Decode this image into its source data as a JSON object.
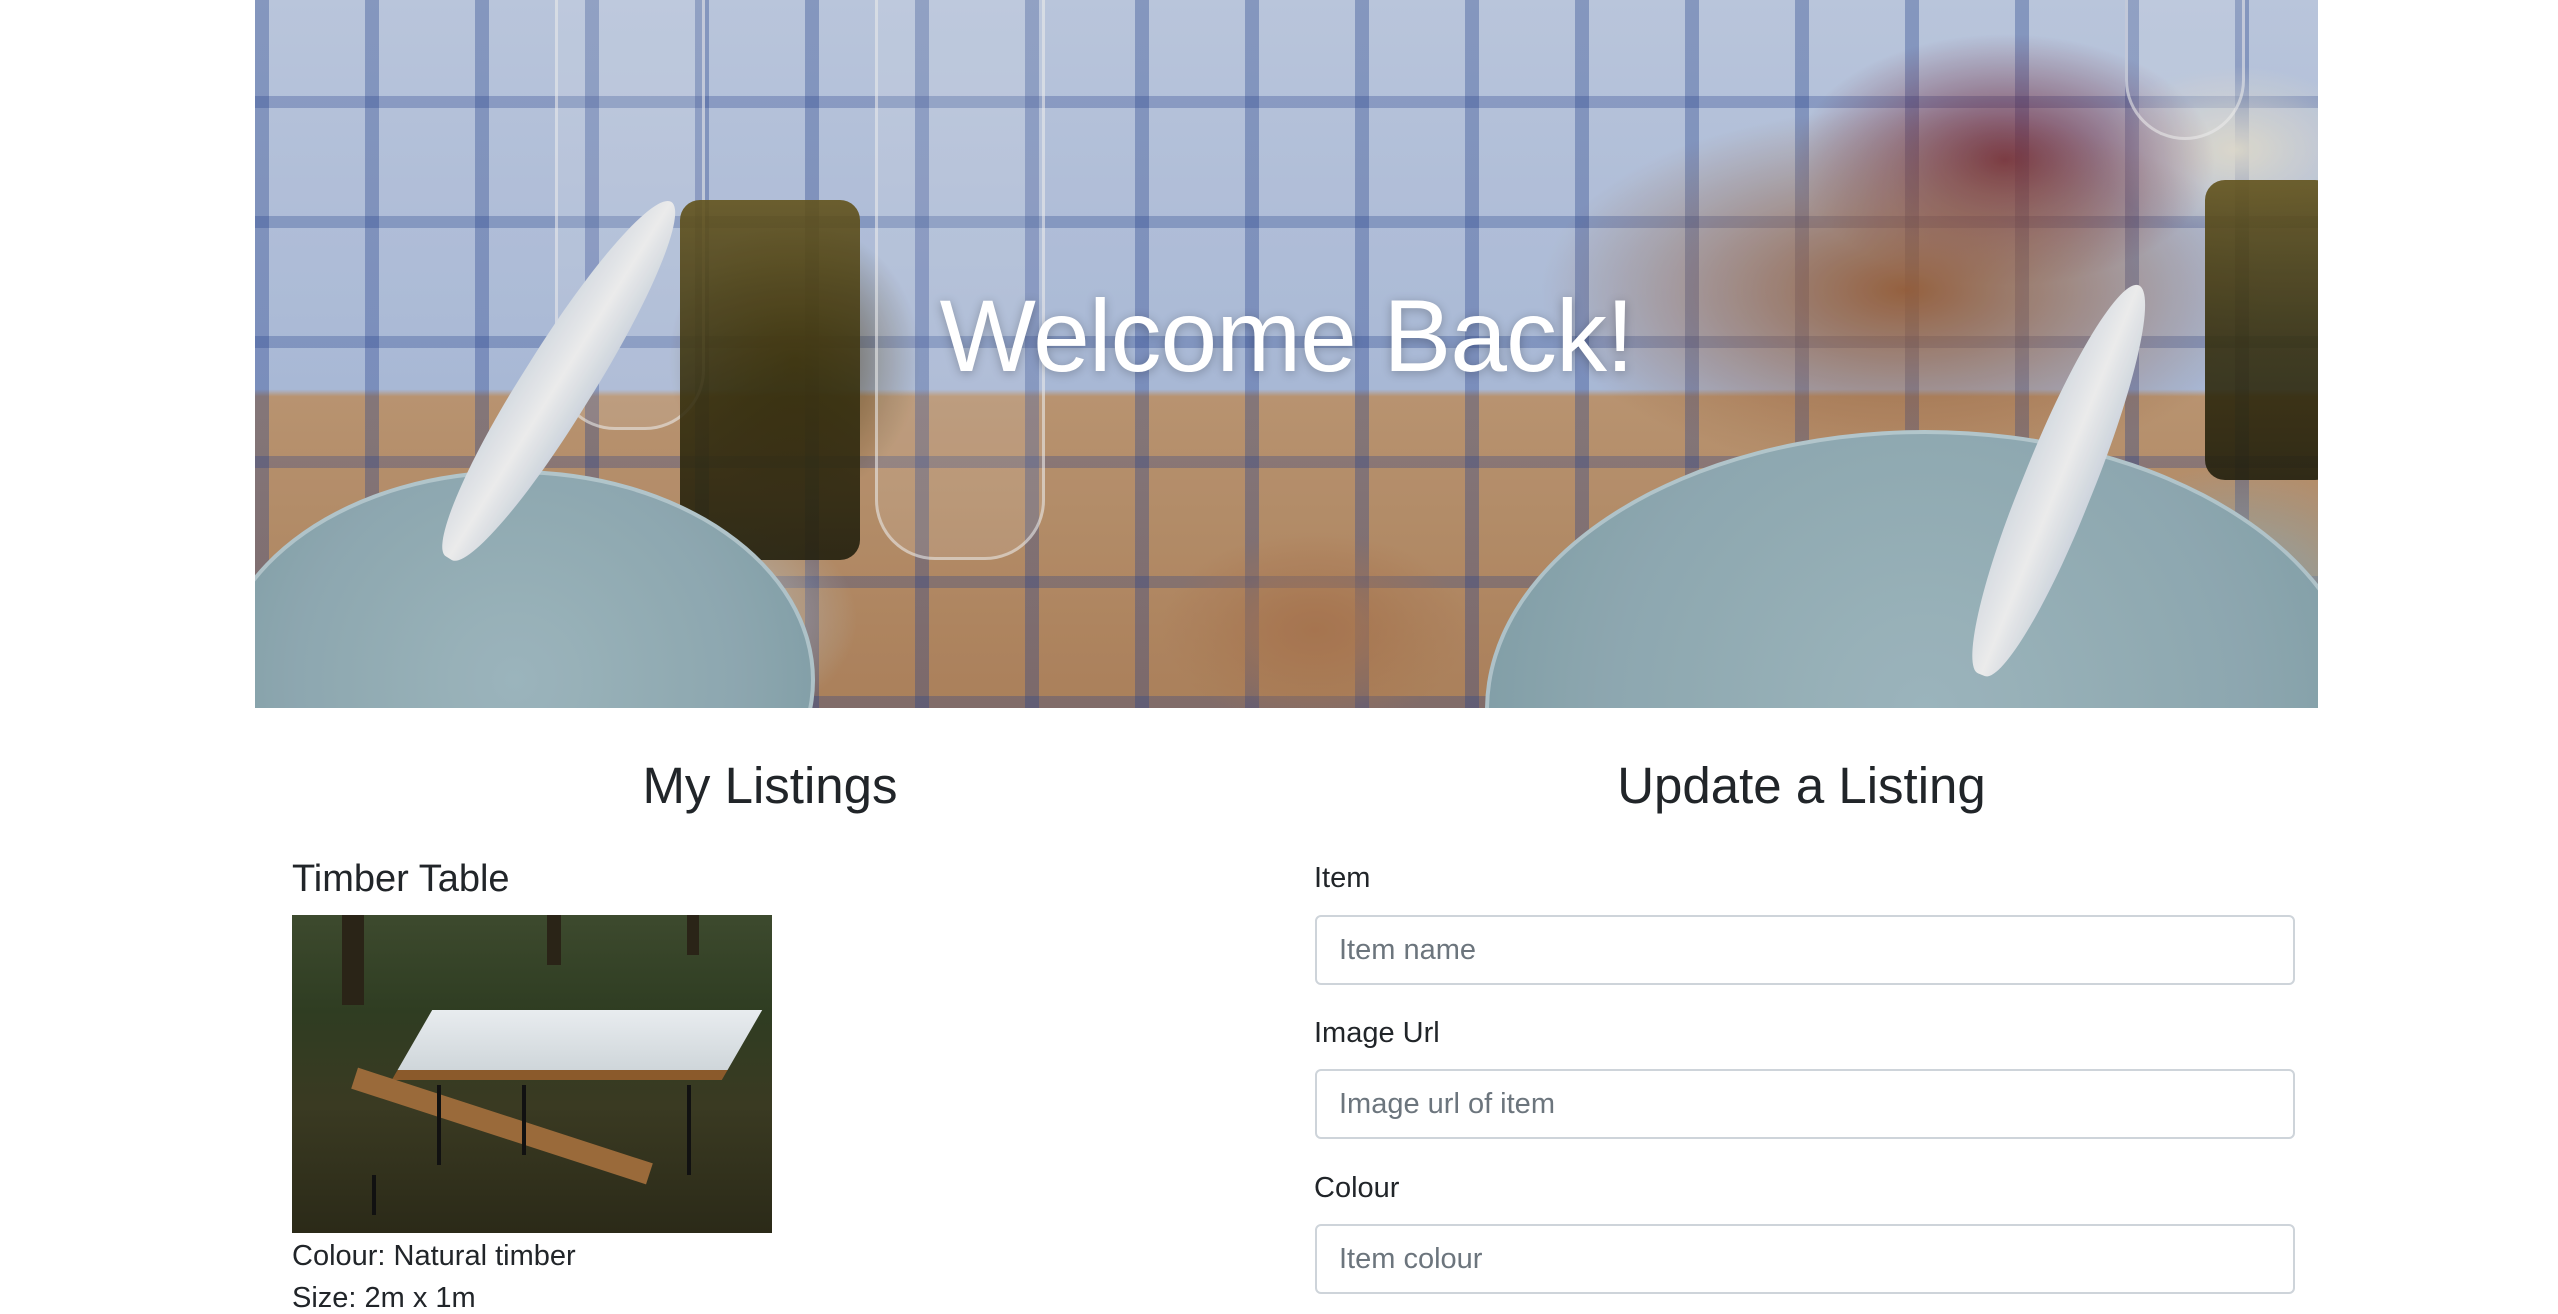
{
  "hero": {
    "title": "Welcome Back!"
  },
  "listings": {
    "heading": "My Listings",
    "items": [
      {
        "name": "Timber Table",
        "colour": "Colour: Natural timber",
        "size": "Size: 2m x 1m"
      }
    ]
  },
  "update_form": {
    "heading": "Update a Listing",
    "fields": [
      {
        "label": "Item",
        "placeholder": "Item name"
      },
      {
        "label": "Image Url",
        "placeholder": "Image url of item"
      },
      {
        "label": "Colour",
        "placeholder": "Item colour"
      }
    ]
  },
  "colors": {
    "text": "#212529",
    "input_border": "#ced4da",
    "placeholder": "#6c757d",
    "hero_title": "#ffffff"
  }
}
